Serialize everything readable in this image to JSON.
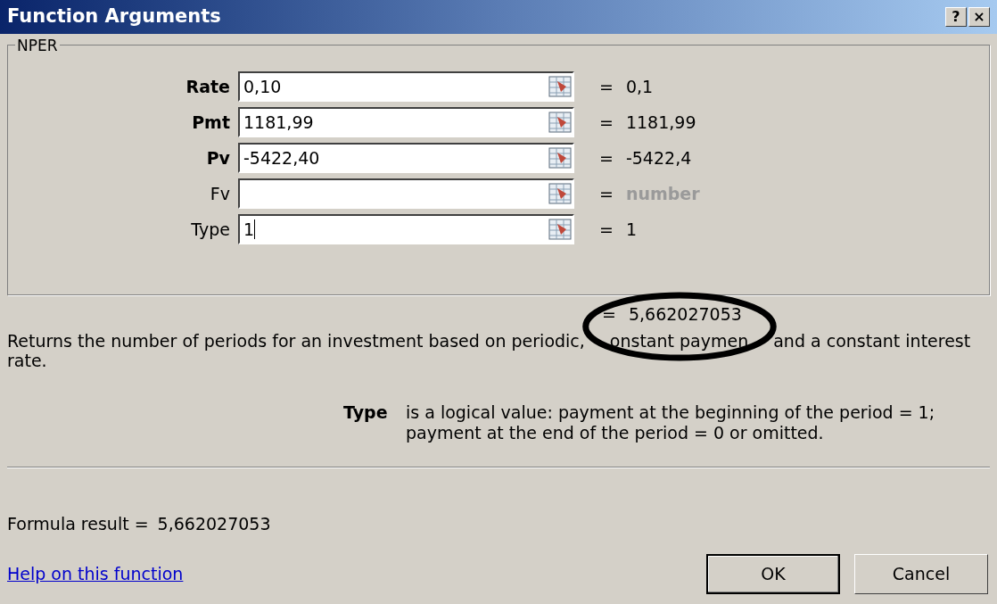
{
  "window": {
    "title": "Function Arguments",
    "buttons": [
      "?",
      "×"
    ]
  },
  "group": {
    "title": "NPER"
  },
  "arguments": [
    {
      "label": "Rate",
      "required": true,
      "value": "0,10",
      "sign": "=",
      "result": "0,1",
      "result_hint": false,
      "focused": false
    },
    {
      "label": "Pmt",
      "required": true,
      "value": "1181,99",
      "sign": "=",
      "result": "1181,99",
      "result_hint": false,
      "focused": false
    },
    {
      "label": "Pv",
      "required": true,
      "value": "-5422,40",
      "sign": "=",
      "result": "-5422,4",
      "result_hint": false,
      "focused": false
    },
    {
      "label": "Fv",
      "required": false,
      "sign": "=",
      "result": "number",
      "result_hint": true,
      "focused": false
    },
    {
      "label": "Type",
      "required": false,
      "value": "1",
      "sign": "=",
      "result": "1",
      "result_hint": false,
      "focused": true
    }
  ],
  "function_result": {
    "sign": "=",
    "value": "5,662027053"
  },
  "description": [
    "Returns the number of periods for an investment based on periodic,",
    "onstant paymen",
    "and a constant interest",
    "rate."
  ],
  "argument_help": {
    "name": "Type",
    "text": "is a logical value: payment at the beginning of the period = 1; payment at the end of the period = 0 or omitted."
  },
  "formula_result": {
    "label": "Formula result =",
    "value": "5,662027053"
  },
  "help_link": "Help on this function",
  "buttons": [
    {
      "label": "OK",
      "default": true
    },
    {
      "label": "Cancel",
      "default": false
    }
  ]
}
